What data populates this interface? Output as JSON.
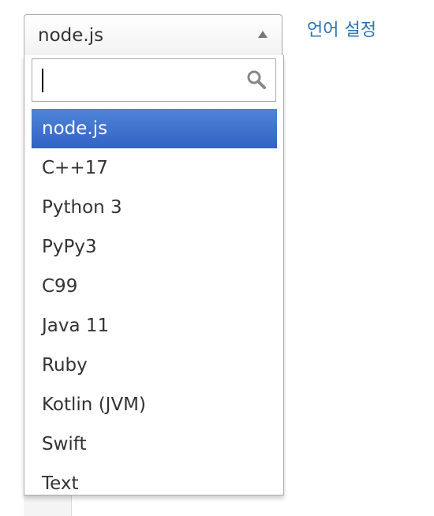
{
  "select": {
    "value": "node.js"
  },
  "lang_link": "언어 설정",
  "search": {
    "value": "",
    "placeholder": ""
  },
  "options": [
    "node.js",
    "C++17",
    "Python 3",
    "PyPy3",
    "C99",
    "Java 11",
    "Ruby",
    "Kotlin (JVM)",
    "Swift",
    "Text"
  ],
  "highlighted_index": 0,
  "colors": {
    "highlight": "#3875d7",
    "link": "#2a72b5",
    "text": "#333333"
  },
  "icons": {
    "search": "search-icon",
    "dropdown_arrow": "arrow-up-icon"
  }
}
